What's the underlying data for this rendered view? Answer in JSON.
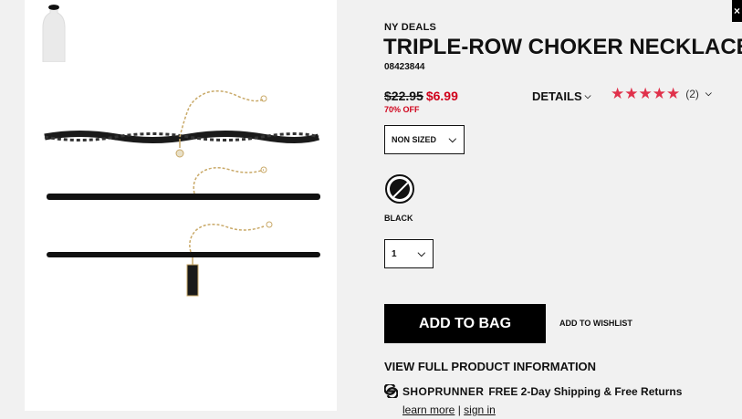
{
  "close": {
    "label": "×"
  },
  "product": {
    "brand": "NY DEALS",
    "title": "TRIPLE-ROW CHOKER NECKLACE",
    "sku": "08423844",
    "price_old": "$22.95",
    "price_new": "$6.99",
    "discount": "70% OFF",
    "rating_stars": 5,
    "rating_count": "(2)"
  },
  "tabs": {
    "details_label": "DETAILS"
  },
  "size_select": {
    "value": "NON SIZED"
  },
  "color": {
    "name": "BLACK"
  },
  "quantity": {
    "value": "1"
  },
  "actions": {
    "add_to_bag": "ADD TO BAG",
    "add_to_wishlist": "ADD TO WISHLIST",
    "view_full_info": "VIEW FULL PRODUCT INFORMATION"
  },
  "shoprunner": {
    "brand": "SHOPRUNNER",
    "text": "FREE 2-Day Shipping & Free Returns",
    "learn_more": "learn more",
    "separator": "|",
    "sign_in": "sign in"
  },
  "colors": {
    "sale_red": "#d0021b",
    "star_red": "#e0314b",
    "button_black": "#000000"
  }
}
